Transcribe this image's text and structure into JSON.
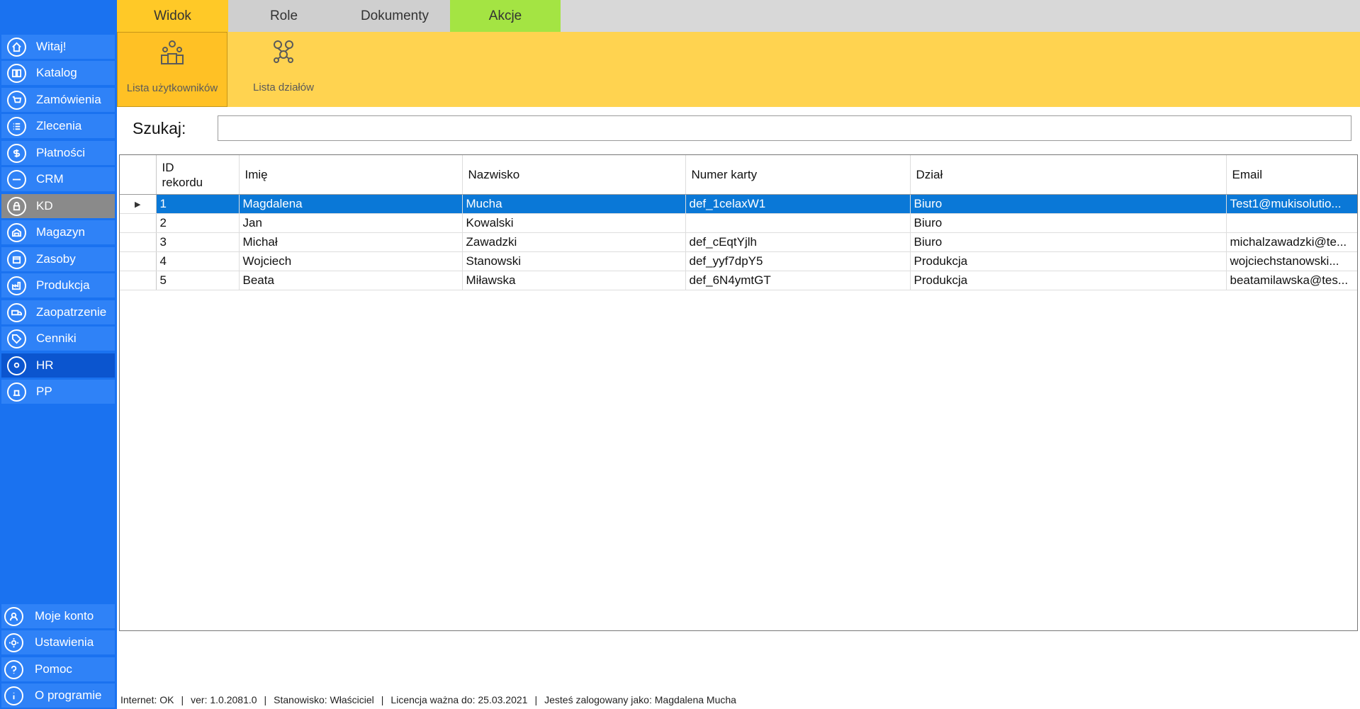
{
  "sidebar": {
    "items": [
      {
        "label": "Witaj!",
        "icon": "home-icon"
      },
      {
        "label": "Katalog",
        "icon": "book-icon"
      },
      {
        "label": "Zamówienia",
        "icon": "cart-icon"
      },
      {
        "label": "Zlecenia",
        "icon": "list-icon"
      },
      {
        "label": "Płatności",
        "icon": "dollar-icon"
      },
      {
        "label": "CRM",
        "icon": "crm-icon"
      },
      {
        "label": "KD",
        "icon": "lock-icon"
      },
      {
        "label": "Magazyn",
        "icon": "warehouse-icon"
      },
      {
        "label": "Zasoby",
        "icon": "box-icon"
      },
      {
        "label": "Produkcja",
        "icon": "factory-icon"
      },
      {
        "label": "Zaopatrzenie",
        "icon": "truck-icon"
      },
      {
        "label": "Cenniki",
        "icon": "tag-icon"
      },
      {
        "label": "HR",
        "icon": "user-badge-icon"
      },
      {
        "label": "PP",
        "icon": "pp-icon"
      }
    ],
    "bottom": [
      {
        "label": "Moje konto",
        "icon": "account-icon"
      },
      {
        "label": "Ustawienia",
        "icon": "gear-icon"
      },
      {
        "label": "Pomoc",
        "icon": "help-icon"
      },
      {
        "label": "O programie",
        "icon": "info-icon"
      }
    ]
  },
  "tabs": {
    "widok": "Widok",
    "role": "Role",
    "dokumenty": "Dokumenty",
    "akcje": "Akcje"
  },
  "ribbon": {
    "users_label": "Lista użytkowników",
    "depts_label": "Lista działów"
  },
  "search": {
    "label": "Szukaj:",
    "value": ""
  },
  "table": {
    "headers": {
      "id_line1": "ID",
      "id_line2": "rekordu",
      "imie": "Imię",
      "nazwisko": "Nazwisko",
      "numer_karty": "Numer karty",
      "dzial": "Dział",
      "email": "Email"
    },
    "selected_marker": "▶",
    "rows": [
      {
        "id": "1",
        "imie": "Magdalena",
        "nazwisko": "Mucha",
        "karta": "def_1celaxW1",
        "dzial": "Biuro",
        "email": "Test1@mukisolutio..."
      },
      {
        "id": "2",
        "imie": "Jan",
        "nazwisko": "Kowalski",
        "karta": "",
        "dzial": "Biuro",
        "email": ""
      },
      {
        "id": "3",
        "imie": "Michał",
        "nazwisko": "Zawadzki",
        "karta": "def_cEqtYjlh",
        "dzial": "Biuro",
        "email": "michalzawadzki@te..."
      },
      {
        "id": "4",
        "imie": "Wojciech",
        "nazwisko": "Stanowski",
        "karta": "def_yyf7dpY5",
        "dzial": "Produkcja",
        "email": "wojciechstanowski..."
      },
      {
        "id": "5",
        "imie": "Beata",
        "nazwisko": "Miławska",
        "karta": "def_6N4ymtGT",
        "dzial": "Produkcja",
        "email": "beatamilawska@tes..."
      }
    ]
  },
  "status": {
    "internet": "Internet: OK",
    "version": "ver: 1.0.2081.0",
    "stanowisko": "Stanowisko: Właściciel",
    "licencja": "Licencja ważna do: 25.03.2021",
    "user": "Jesteś zalogowany jako: Magdalena Mucha",
    "separator": "|"
  },
  "colors": {
    "sidebar": "#1a72f0",
    "tab_active": "#ffc927",
    "tab_akcje": "#a4e443",
    "ribbon": "#ffd350",
    "row_selected": "#0a78d7"
  }
}
